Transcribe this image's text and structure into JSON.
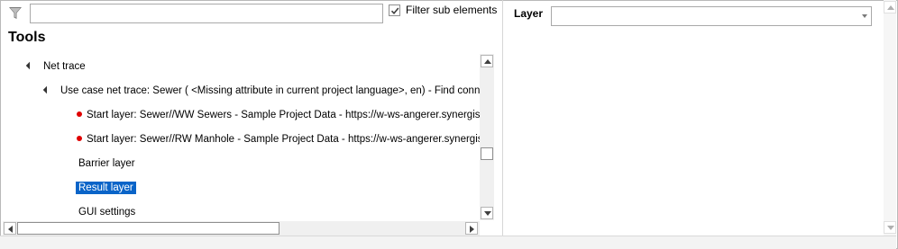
{
  "filter": {
    "placeholder": "",
    "value": "",
    "checkbox_checked": true,
    "checkbox_label": "Filter sub elements"
  },
  "tools": {
    "heading": "Tools",
    "tree": [
      {
        "label": "Net trace",
        "level": 0,
        "expanded": true
      },
      {
        "label": "Use case net trace: Sewer ( <Missing attribute in current project language>, en) - Find connected",
        "level": 1,
        "expanded": true
      },
      {
        "label": "Start layer: Sewer//WW Sewers - Sample Project Data - https://w-ws-angerer.synergis.com/arcgis",
        "level": 2,
        "marker": "red-dot"
      },
      {
        "label": "Start layer: Sewer//RW Manhole - Sample Project Data - https://w-ws-angerer.synergis.com/arcgis",
        "level": 2,
        "marker": "red-dot"
      },
      {
        "label": "Barrier layer",
        "level": 2
      },
      {
        "label": "Result layer",
        "level": 2,
        "selected": true
      },
      {
        "label": "GUI settings",
        "level": 2
      }
    ]
  },
  "right_panel": {
    "layer_label": "Layer",
    "layer_value": ""
  },
  "colors": {
    "selection": "#0a64c8",
    "marker": "#e00000"
  }
}
